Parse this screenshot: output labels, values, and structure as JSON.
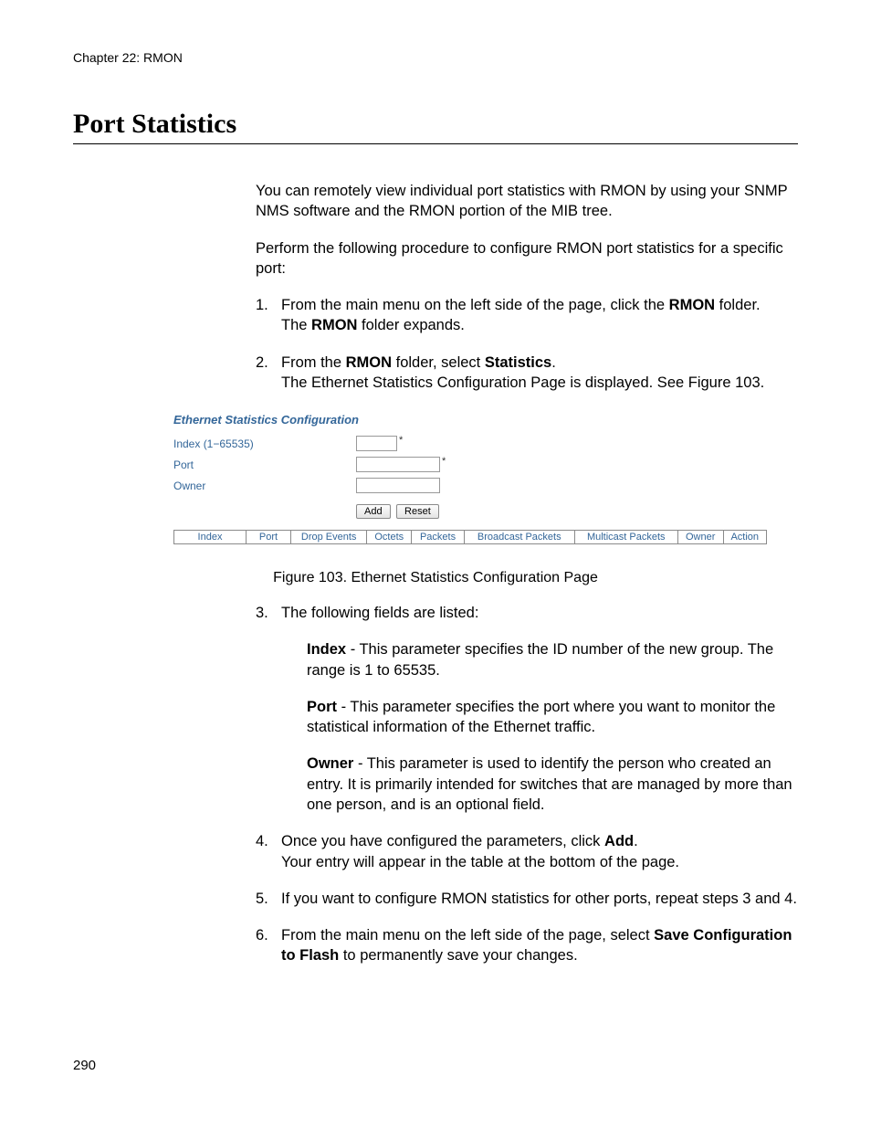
{
  "chapter": "Chapter 22: RMON",
  "section_title": "Port Statistics",
  "intro1": "You can remotely view individual port statistics with RMON by using your SNMP NMS software and the RMON portion of the MIB tree.",
  "intro2": "Perform the following procedure to configure RMON port statistics for a specific port:",
  "step1_a": "From the main menu on the left side of the page, click the ",
  "step1_b": "RMON",
  "step1_c": " folder.",
  "step1_d": "The ",
  "step1_e": "RMON",
  "step1_f": " folder expands.",
  "step2_a": "From the ",
  "step2_b": "RMON",
  "step2_c": " folder, select ",
  "step2_d": "Statistics",
  "step2_e": ".",
  "step2_f": "The Ethernet Statistics Configuration Page is displayed. See Figure 103.",
  "fig": {
    "heading": "Ethernet Statistics Configuration",
    "label_index": "Index (1−65535)",
    "label_port": "Port",
    "label_owner": "Owner",
    "btn_add": "Add",
    "btn_reset": "Reset",
    "cols": {
      "c0": "Index",
      "c1": "Port",
      "c2": "Drop Events",
      "c3": "Octets",
      "c4": "Packets",
      "c5": "Broadcast Packets",
      "c6": "Multicast Packets",
      "c7": "Owner",
      "c8": "Action"
    }
  },
  "figure_caption": "Figure 103. Ethernet Statistics Configuration Page",
  "step3_intro": "The following fields are listed:",
  "def_index_b": "Index",
  "def_index_t": " - This parameter specifies the ID number of the new group. The range is 1 to 65535.",
  "def_port_b": "Port",
  "def_port_t": " - This parameter specifies the port where you want to monitor the statistical information of the Ethernet traffic.",
  "def_owner_b": "Owner",
  "def_owner_t": " - This parameter is used to identify the person who created an entry. It is primarily intended for switches that are managed by more than one person, and is an optional field.",
  "step4_a": "Once you have configured the parameters, click ",
  "step4_b": "Add",
  "step4_c": ".",
  "step4_d": "Your entry will appear in the table at the bottom of the page.",
  "step5": "If you want to configure RMON statistics for other ports, repeat steps 3 and 4.",
  "step6_a": "From the main menu on the left side of the page, select ",
  "step6_b": "Save Configuration to Flash",
  "step6_c": " to permanently save your changes.",
  "page_number": "290"
}
